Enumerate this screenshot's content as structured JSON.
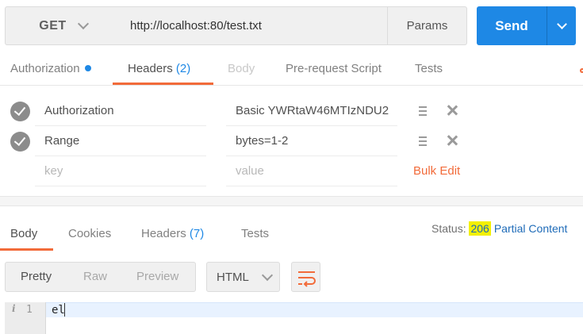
{
  "request": {
    "method": "GET",
    "url": "http://localhost:80/test.txt",
    "params_label": "Params",
    "send_label": "Send"
  },
  "request_tabs": {
    "authorization": "Authorization",
    "headers": "Headers",
    "headers_count": "(2)",
    "body": "Body",
    "prerequest": "Pre-request Script",
    "tests": "Tests"
  },
  "headers": [
    {
      "key": "Authorization",
      "value": "Basic YWRtaW46MTIzNDU2",
      "enabled": true
    },
    {
      "key": "Range",
      "value": "bytes=1-2",
      "enabled": true
    }
  ],
  "new_header": {
    "key_placeholder": "key",
    "value_placeholder": "value",
    "bulk_edit": "Bulk Edit"
  },
  "response_tabs": {
    "body": "Body",
    "cookies": "Cookies",
    "headers": "Headers",
    "headers_count": "(7)",
    "tests": "Tests"
  },
  "status": {
    "label": "Status:",
    "code": "206",
    "text": "Partial Content"
  },
  "view_modes": {
    "pretty": "Pretty",
    "raw": "Raw",
    "preview": "Preview",
    "active": "Pretty"
  },
  "format": "HTML",
  "code": {
    "line_number": "1",
    "info_glyph": "i",
    "content": "el"
  },
  "icons": {
    "method_dropdown": "chevron-down-icon",
    "send_dropdown": "chevron-down-icon",
    "header_enabled": "check-circle-icon",
    "drag": "drag-handle-icon",
    "remove": "close-icon",
    "wrap": "wrap-lines-icon",
    "format_dropdown": "chevron-down-icon"
  },
  "colors": {
    "accent": "#f26b3a",
    "primary": "#1e88e5",
    "status_highlight": "#f3f000"
  }
}
